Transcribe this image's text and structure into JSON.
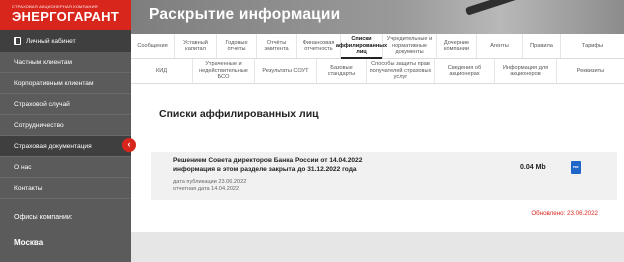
{
  "sidebar": {
    "logo_small": "СТРАХОВАЯ АКЦИОНЕРНАЯ КОМПАНИЯ",
    "logo_main": "ЭНЕРГОГАРАНТ",
    "cabinet_label": "Личный кабинет",
    "items": [
      {
        "label": "Частным клиентам"
      },
      {
        "label": "Корпоративным клиентам"
      },
      {
        "label": "Страховой случай"
      },
      {
        "label": "Сотрудничество"
      },
      {
        "label": "Страховая документация"
      },
      {
        "label": "О нас"
      },
      {
        "label": "Контакты"
      }
    ],
    "active_item": "Страховая документация",
    "offices_label": "Офисы компании:",
    "city": "Москва"
  },
  "header": {
    "title": "Раскрытие информации"
  },
  "tabs_row1": [
    {
      "label": "Сообщения"
    },
    {
      "label": "Уставный капитал"
    },
    {
      "label": "Годовые отчеты"
    },
    {
      "label": "Отчёты эмитента"
    },
    {
      "label": "Финансовая отчетность"
    },
    {
      "label": "Списки аффилированных лиц"
    },
    {
      "label": "Учредительные и нормативные документы"
    },
    {
      "label": "Дочерние компании"
    },
    {
      "label": "Агенты"
    },
    {
      "label": "Правила"
    },
    {
      "label": "Тарифы"
    }
  ],
  "tabs_row2": [
    {
      "label": "КИД"
    },
    {
      "label": "Утраченные и недействительные БСО"
    },
    {
      "label": "Результаты СОУТ"
    },
    {
      "label": "Базовые стандарты"
    },
    {
      "label": "Способы защиты прав получателей страховых услуг"
    },
    {
      "label": "Сведения об акционерах"
    },
    {
      "label": "Информация для акционеров"
    },
    {
      "label": "Реквизиты"
    }
  ],
  "main": {
    "heading": "Списки аффилированных лиц",
    "document": {
      "title_line1": "Решением Совета директоров Банка России от 14.04.2022",
      "title_line2": "информация в этом разделе закрыта до 31.12.2022 года",
      "published": "дата публикации 23.06.2022",
      "report_date": "отчетная дата 14.04.2022",
      "size": "0.04 Mb",
      "file_type": "PDF"
    },
    "updated": "Обновлено: 23.06.2022"
  },
  "colors": {
    "brand_red": "#d9261c",
    "sidebar_bg": "#5b5b5b",
    "sidebar_active": "#3f3f3f",
    "pdf_blue": "#1e66c8"
  }
}
